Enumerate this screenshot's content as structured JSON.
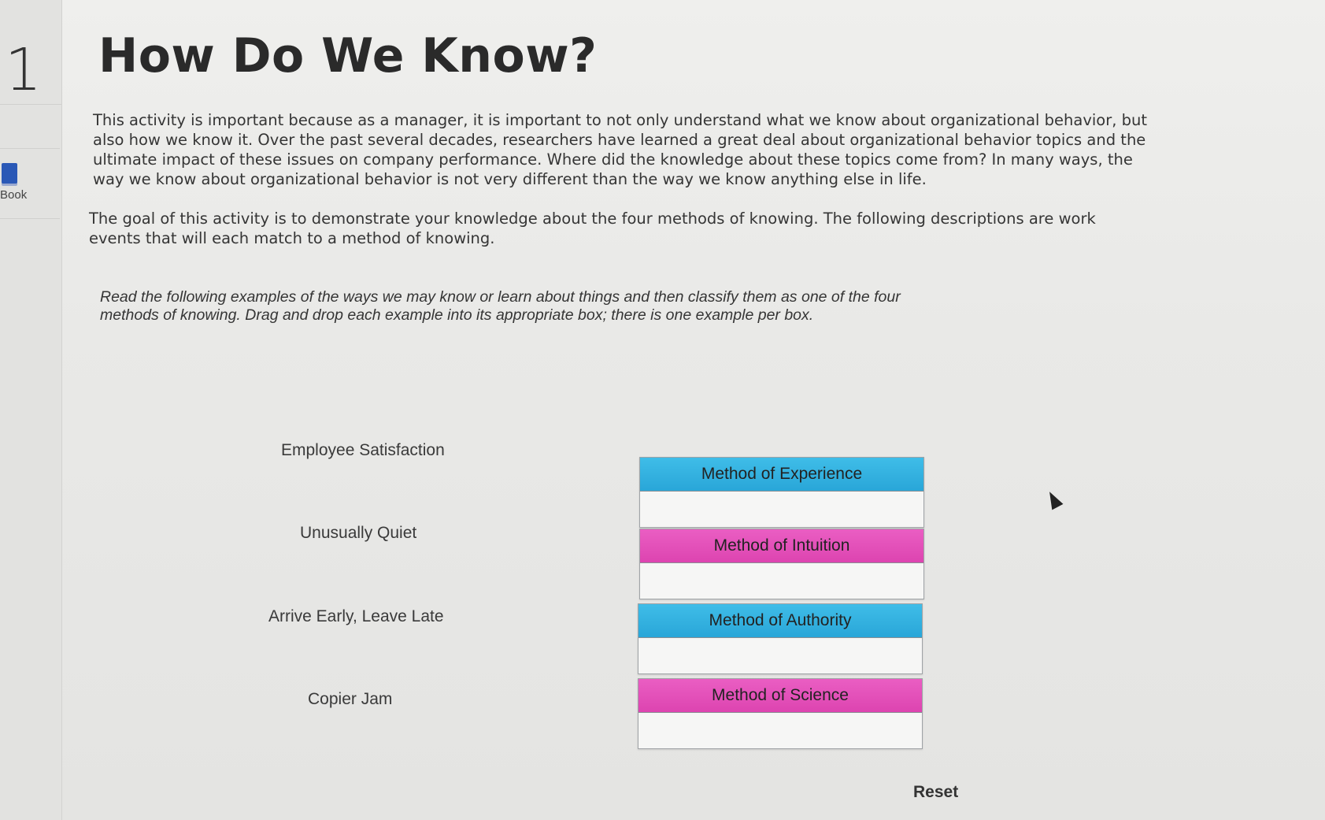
{
  "question": {
    "number": "1",
    "title": "How Do We Know?"
  },
  "tools": {
    "ebook_label": "Book"
  },
  "intro_text": "This activity is important because as a manager, it is important to not only understand what we know about organizational behavior, but also how we know it. Over the past several decades, researchers have learned a great deal about organizational behavior topics and the ultimate impact of these issues on company performance. Where did the knowledge about these topics come from? In many ways, the way we know about organizational behavior is not very different than the way we know anything else in life.",
  "goal_text": "The goal of this activity is to demonstrate your knowledge about the four methods of knowing. The following descriptions are work events that will each match to a method of knowing.",
  "instructions_text": "Read the following examples of the ways we may know or learn about things and then classify them as one of the four methods of knowing. Drag and drop each example into its appropriate box; there is one example per box.",
  "examples": [
    "Employee Satisfaction",
    "Unusually Quiet",
    "Arrive Early, Leave Late",
    "Copier Jam"
  ],
  "targets": [
    {
      "label": "Method of Experience",
      "color": "#29a6d8"
    },
    {
      "label": "Method of Intuition",
      "color": "#dd44b0"
    },
    {
      "label": "Method of Authority",
      "color": "#29a6d8"
    },
    {
      "label": "Method of Science",
      "color": "#dd44b0"
    }
  ],
  "reset_label": "Reset"
}
